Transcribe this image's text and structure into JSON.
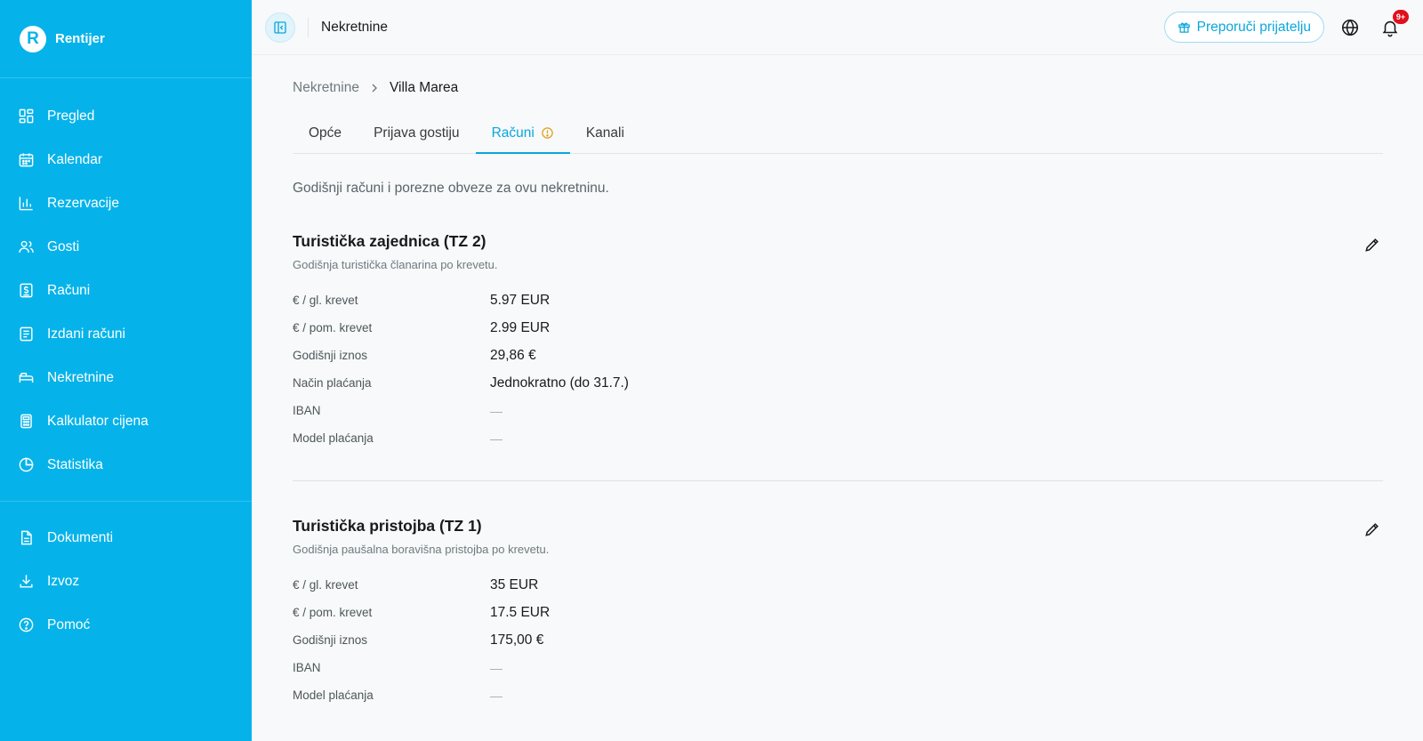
{
  "brand": {
    "logo_letter": "R",
    "name": "Rentijer"
  },
  "sidebar": {
    "items": [
      {
        "label": "Pregled",
        "icon": "grid-icon"
      },
      {
        "label": "Kalendar",
        "icon": "calendar-icon"
      },
      {
        "label": "Rezervacije",
        "icon": "bar-chart-icon"
      },
      {
        "label": "Gosti",
        "icon": "users-icon"
      },
      {
        "label": "Računi",
        "icon": "receipt-icon"
      },
      {
        "label": "Izdani računi",
        "icon": "document-list-icon"
      },
      {
        "label": "Nekretnine",
        "icon": "bed-icon"
      },
      {
        "label": "Kalkulator cijena",
        "icon": "calculator-icon"
      },
      {
        "label": "Statistika",
        "icon": "pie-chart-icon"
      }
    ],
    "secondary_items": [
      {
        "label": "Dokumenti",
        "icon": "file-icon"
      },
      {
        "label": "Izvoz",
        "icon": "download-icon"
      },
      {
        "label": "Pomoć",
        "icon": "help-icon"
      }
    ]
  },
  "header": {
    "title": "Nekretnine",
    "refer_label": "Preporuči prijatelju",
    "notification_badge": "9+"
  },
  "breadcrumb": {
    "parent": "Nekretnine",
    "current": "Villa Marea"
  },
  "tabs": [
    {
      "label": "Opće",
      "active": false
    },
    {
      "label": "Prijava gostiju",
      "active": false
    },
    {
      "label": "Računi",
      "active": true,
      "warning": true
    },
    {
      "label": "Kanali",
      "active": false
    }
  ],
  "intro": "Godišnji računi i porezne obveze za ovu nekretninu.",
  "sections": [
    {
      "title": "Turistička zajednica (TZ 2)",
      "subtitle": "Godišnja turistička članarina po krevetu.",
      "rows": [
        {
          "label": "€ / gl. krevet",
          "value": "5.97 EUR"
        },
        {
          "label": "€ / pom. krevet",
          "value": "2.99 EUR"
        },
        {
          "label": "Godišnji iznos",
          "value": "29,86 €"
        },
        {
          "label": "Način plaćanja",
          "value": "Jednokratno (do 31.7.)"
        },
        {
          "label": "IBAN",
          "value": "—"
        },
        {
          "label": "Model plaćanja",
          "value": "—"
        }
      ]
    },
    {
      "title": "Turistička pristojba (TZ 1)",
      "subtitle": "Godišnja paušalna boravišna pristojba po krevetu.",
      "rows": [
        {
          "label": "€ / gl. krevet",
          "value": "35 EUR"
        },
        {
          "label": "€ / pom. krevet",
          "value": "17.5 EUR"
        },
        {
          "label": "Godišnji iznos",
          "value": "175,00 €"
        },
        {
          "label": "IBAN",
          "value": "—"
        },
        {
          "label": "Model plaćanja",
          "value": "—"
        }
      ]
    }
  ],
  "colors": {
    "sidebar": "#05b3ea",
    "accent": "#0aa7dc",
    "warning": "#e0a014",
    "badge": "#e0101e"
  }
}
